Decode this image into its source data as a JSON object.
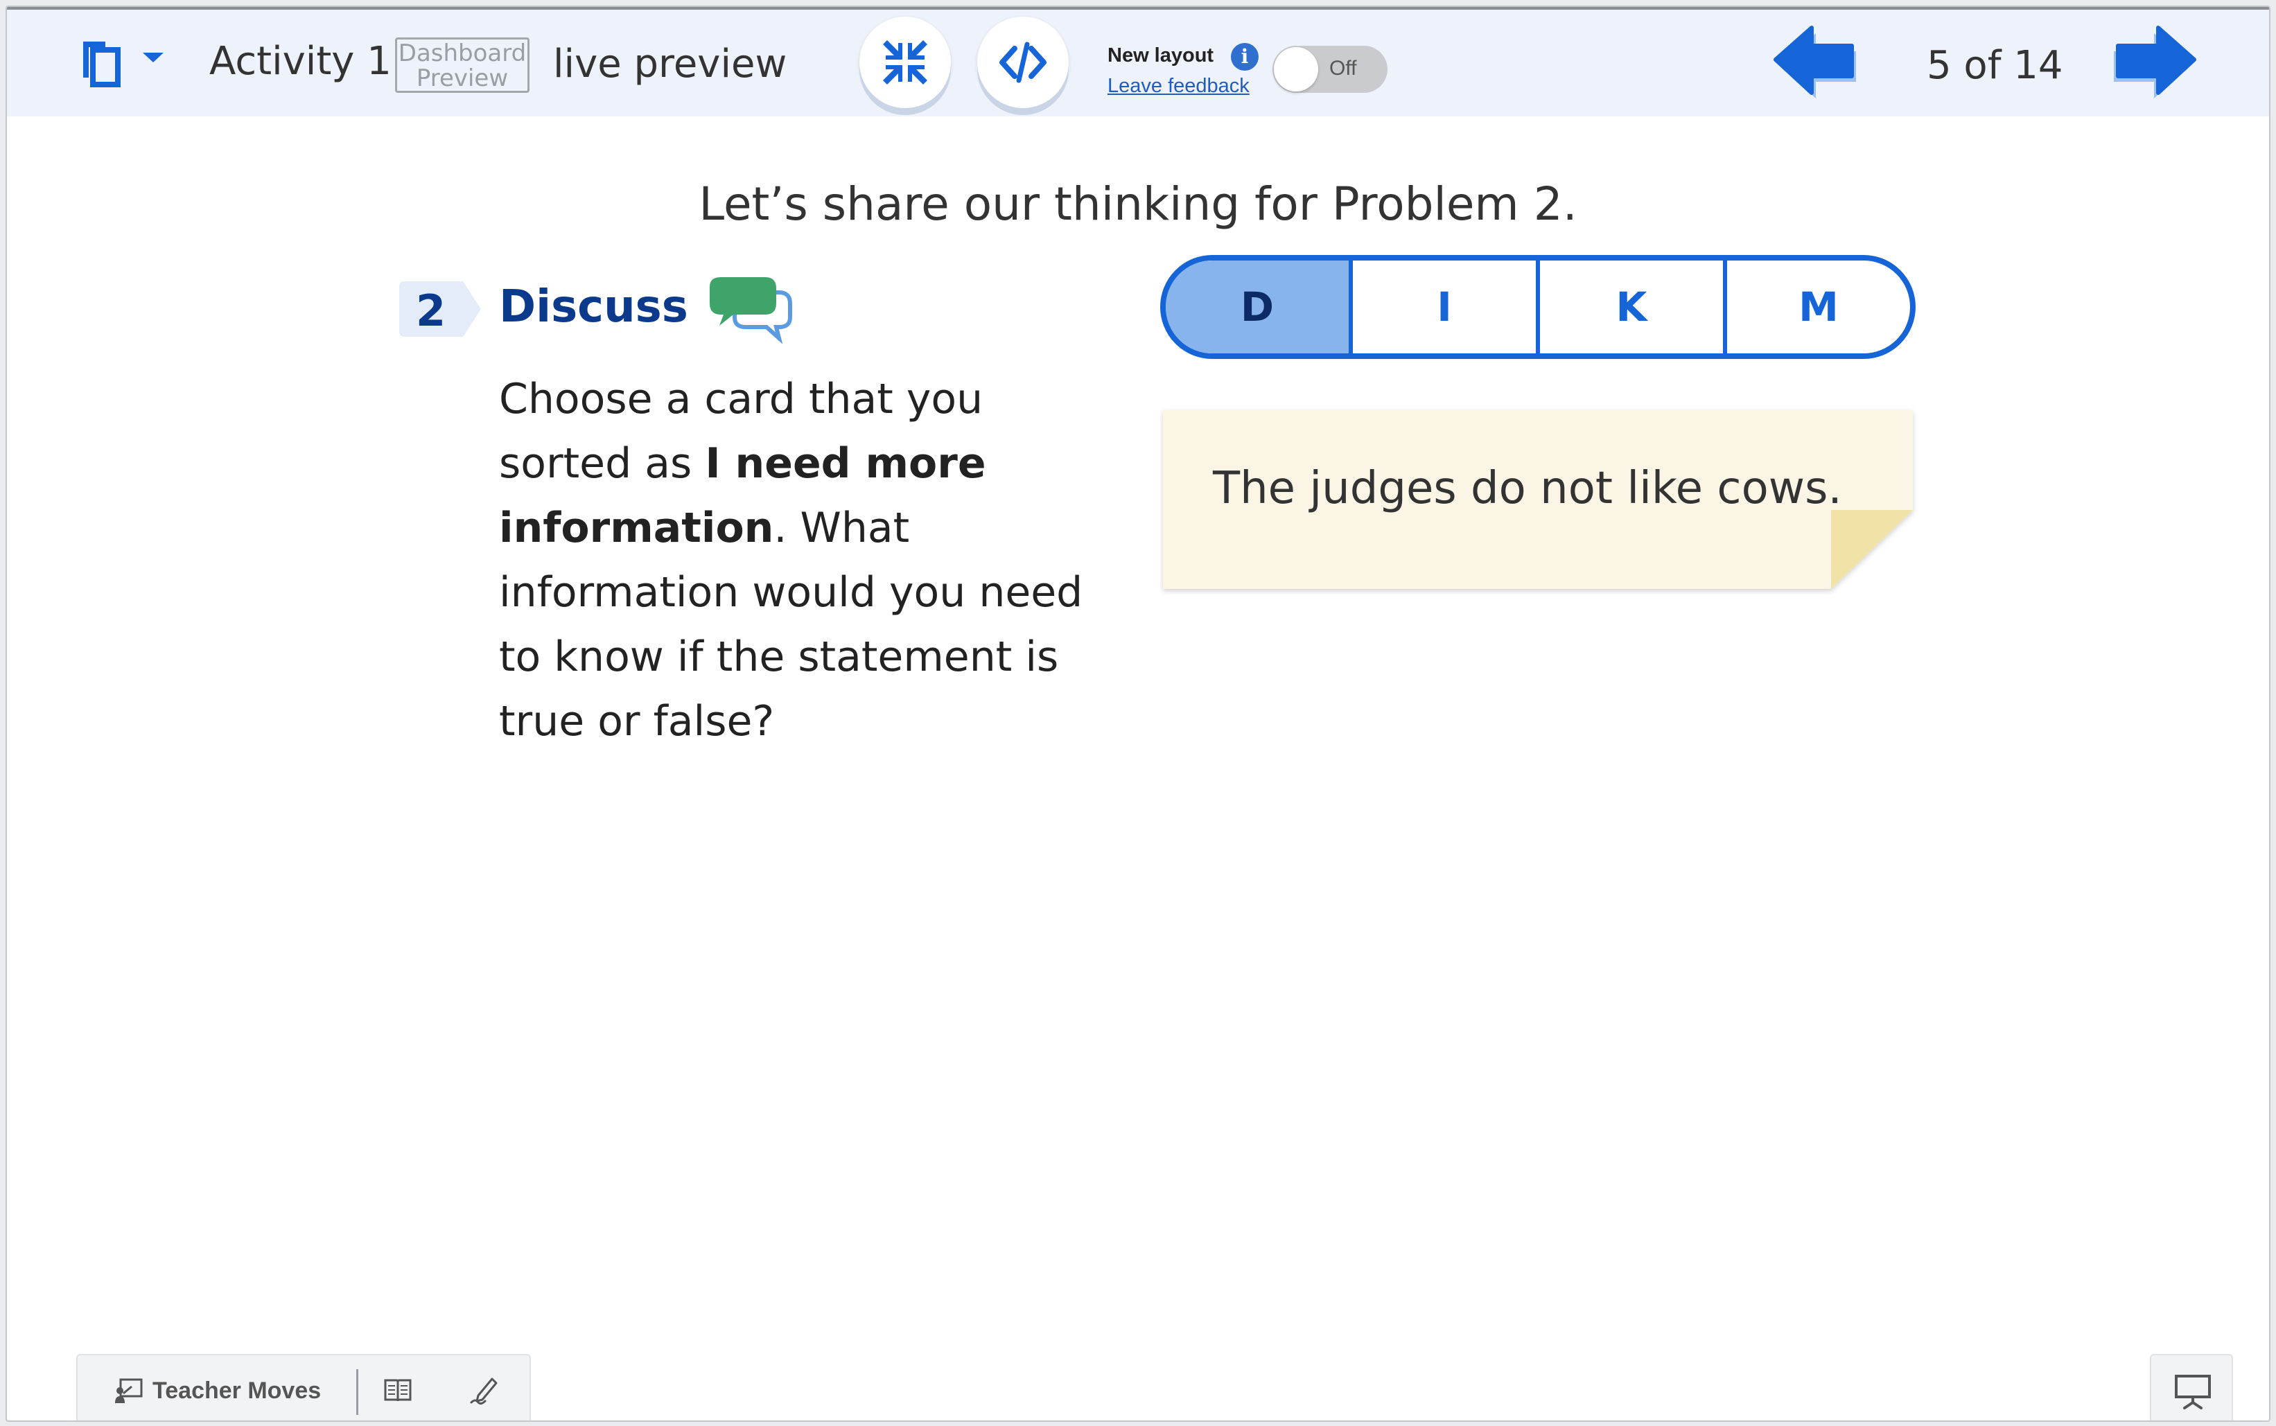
{
  "topbar": {
    "activity_title": "Activity 1",
    "dashboard_badge_line1": "Dashboard",
    "dashboard_badge_line2": "Preview",
    "live_preview": "live preview",
    "new_layout_label": "New layout",
    "info_glyph": "i",
    "leave_feedback": "Leave feedback",
    "toggle_state": "Off",
    "page_counter": "5 of 14",
    "icons": [
      "copy-icon",
      "caret-down-icon",
      "collapse-icon",
      "code-icon",
      "info-icon",
      "arrow-left-icon",
      "arrow-right-icon"
    ]
  },
  "main": {
    "heading": "Let’s share our thinking for Problem 2.",
    "step_number": "2",
    "step_title": "Discuss",
    "prompt": {
      "part1": "Choose a card that you sorted as ",
      "bold": "I need more information",
      "part2": ". What information would you need to know if the statement is true or false?"
    },
    "tabs": [
      {
        "label": "D",
        "active": true
      },
      {
        "label": "I",
        "active": false
      },
      {
        "label": "K",
        "active": false
      },
      {
        "label": "M",
        "active": false
      }
    ],
    "card_text": "The judges do not like cows."
  },
  "bottom_bar": {
    "teacher_moves": "Teacher Moves",
    "icons": [
      "teacher-moves-icon",
      "book-icon",
      "pen-icon",
      "presentation-icon"
    ]
  },
  "colors": {
    "brand_blue": "#1565d8",
    "dark_blue": "#0b3a8c",
    "active_tab": "#88b4ee",
    "card_bg": "#fbf5e6",
    "chat_green": "#3fa46a",
    "topbar_bg": "#eef2fa"
  }
}
